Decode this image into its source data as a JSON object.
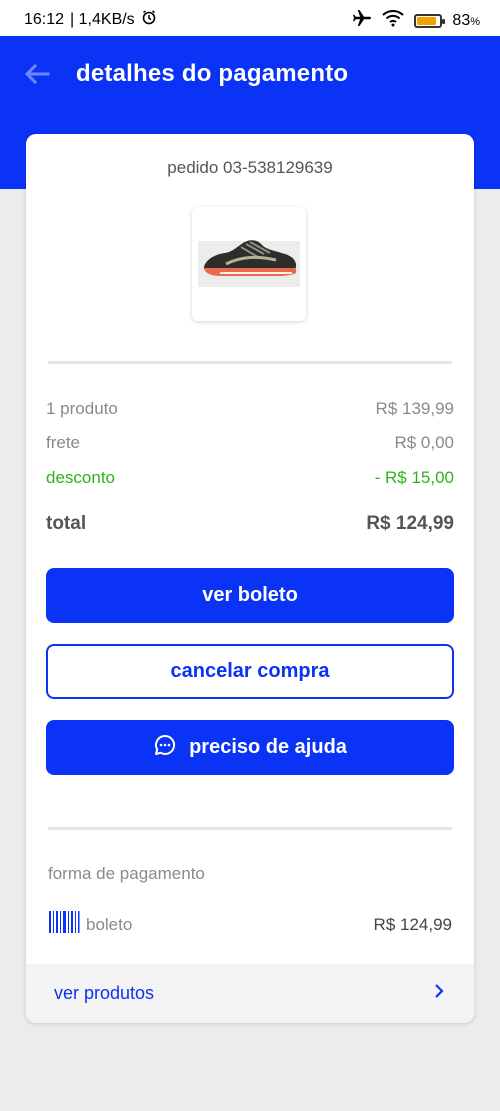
{
  "status_bar": {
    "time": "16:12",
    "network_speed": "| 1,4KB/s",
    "battery_percent": "83",
    "battery_unit": "%",
    "battery_level": 0.83,
    "icons": [
      "alarm-icon",
      "airplane-icon",
      "wifi-icon",
      "battery-icon"
    ]
  },
  "header": {
    "title": "detalhes do pagamento",
    "back_icon": "arrow-left-icon"
  },
  "order": {
    "id_text": "pedido 03-538129639",
    "product_image": "running-shoe-image"
  },
  "summary": {
    "products_label": "1 produto",
    "products_value": "R$ 139,99",
    "shipping_label": "frete",
    "shipping_value": "R$ 0,00",
    "discount_label": "desconto",
    "discount_value": "- R$ 15,00",
    "total_label": "total",
    "total_value": "R$ 124,99"
  },
  "actions": {
    "view_boleto": "ver boleto",
    "cancel_purchase": "cancelar compra",
    "need_help": "preciso de ajuda",
    "help_icon": "chat-bubble-icon"
  },
  "payment": {
    "section_label": "forma de pagamento",
    "method_icon": "barcode-icon",
    "method_name": "boleto",
    "amount": "R$ 124,99"
  },
  "footer": {
    "link_label": "ver produtos",
    "chevron_icon": "chevron-right-icon"
  },
  "colors": {
    "primary": "#0a33f5",
    "discount_green": "#2fb21d",
    "background": "#ececec"
  }
}
